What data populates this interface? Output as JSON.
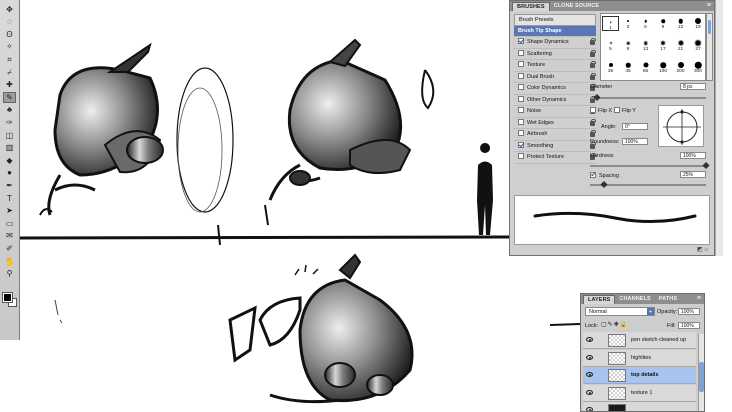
{
  "toolbox": {
    "tools": [
      "move-icon",
      "marquee-icon",
      "lasso-icon",
      "magic-wand-icon",
      "crop-icon",
      "slice-icon",
      "healing-icon",
      "brush-icon",
      "stamp-icon",
      "history-brush-icon",
      "eraser-icon",
      "gradient-icon",
      "blur-icon",
      "dodge-icon",
      "pen-icon",
      "type-icon",
      "path-select-icon",
      "shape-icon",
      "notes-icon",
      "eyedropper-icon",
      "hand-icon",
      "zoom-icon"
    ],
    "glyphs": [
      "✥",
      "◌",
      "ʘ",
      "✧",
      "⌗",
      "⌿",
      "✚",
      "✎",
      "♣",
      "✑",
      "◫",
      "▥",
      "◆",
      "●",
      "✒",
      "T",
      "➤",
      "▭",
      "✉",
      "✐",
      "✋",
      "⚲"
    ],
    "active_index": 7
  },
  "brushes_panel": {
    "tabs": [
      "BRUSHES",
      "CLONE SOURCE"
    ],
    "menu_glyph": "≡",
    "presets_label": "Brush Presets",
    "options": [
      {
        "label": "Brush Tip Shape",
        "checkbox": false,
        "selected": true
      },
      {
        "label": "Shape Dynamics",
        "checkbox": true,
        "checked": true
      },
      {
        "label": "Scattering",
        "checkbox": true,
        "checked": false
      },
      {
        "label": "Texture",
        "checkbox": true,
        "checked": false
      },
      {
        "label": "Dual Brush",
        "checkbox": true,
        "checked": false
      },
      {
        "label": "Color Dynamics",
        "checkbox": true,
        "checked": false
      },
      {
        "label": "Other Dynamics",
        "checkbox": true,
        "checked": false
      },
      {
        "label": "Noise",
        "checkbox": true,
        "checked": false
      },
      {
        "label": "Wet Edges",
        "checkbox": true,
        "checked": false
      },
      {
        "label": "Airbrush",
        "checkbox": true,
        "checked": false
      },
      {
        "label": "Smoothing",
        "checkbox": true,
        "checked": true
      },
      {
        "label": "Protect Texture",
        "checkbox": true,
        "checked": false
      }
    ],
    "tips": [
      {
        "size": "1",
        "dot": 1.5
      },
      {
        "size": "3",
        "dot": 2
      },
      {
        "size": "5",
        "dot": 2.5
      },
      {
        "size": "9",
        "dot": 3.5
      },
      {
        "size": "13",
        "dot": 4.5
      },
      {
        "size": "19",
        "dot": 6
      },
      {
        "size": "5",
        "dot": 2
      },
      {
        "size": "9",
        "dot": 2.5
      },
      {
        "size": "13",
        "dot": 3.5
      },
      {
        "size": "17",
        "dot": 4
      },
      {
        "size": "21",
        "dot": 5
      },
      {
        "size": "27",
        "dot": 6
      },
      {
        "size": "35",
        "dot": 4
      },
      {
        "size": "45",
        "dot": 4.5
      },
      {
        "size": "65",
        "dot": 5
      },
      {
        "size": "100",
        "dot": 5.5
      },
      {
        "size": "200",
        "dot": 6
      },
      {
        "size": "300",
        "dot": 6.5
      }
    ],
    "diameter_label": "Diameter",
    "diameter_value": "8 px",
    "flip_x": "Flip X",
    "flip_y": "Flip Y",
    "angle_label": "Angle:",
    "angle_value": "0°",
    "roundness_label": "Roundness:",
    "roundness_value": "100%",
    "hardness_label": "Hardness",
    "hardness_value": "100%",
    "spacing_label": "Spacing",
    "spacing_value": "25%",
    "spacing_checked": true,
    "footer_icons": "◩ ⌂"
  },
  "layers_panel": {
    "tabs": [
      "LAYERS",
      "CHANNELS",
      "PATHS"
    ],
    "menu_glyph": "≡",
    "blend_mode": "Normal",
    "opacity_label": "Opacity:",
    "opacity_value": "100%",
    "lock_label": "Lock:",
    "fill_label": "Fill:",
    "fill_value": "100%",
    "layers": [
      {
        "name": "pen sketch cleaned up",
        "selected": false,
        "dark": false
      },
      {
        "name": "highlites",
        "selected": false,
        "dark": false
      },
      {
        "name": "top details",
        "selected": true,
        "dark": false
      },
      {
        "name": "texture 1",
        "selected": false,
        "dark": false
      },
      {
        "name": "",
        "selected": false,
        "dark": true
      }
    ]
  }
}
